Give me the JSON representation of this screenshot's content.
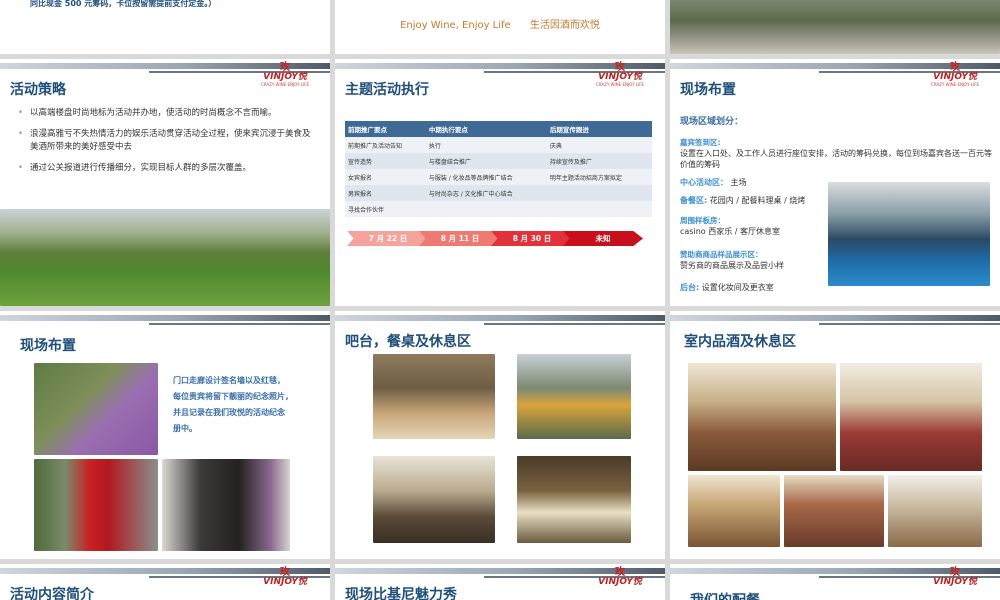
{
  "colors": {
    "title": "#1f4f7a",
    "accent": "#3f8fcf",
    "tagline": "#c77a2e",
    "logo": "#c81e1e",
    "table_header": "#3e6a95"
  },
  "logo": {
    "cn": "玫",
    "en": "VINJOY悦",
    "sub": "CRAZY WINE ENJOY LIFE"
  },
  "top_row": {
    "note": "同比现金 500 元筹码，卡位按留需提前支付定金。）",
    "tagline_en": "Enjoy Wine, Enjoy Life",
    "tagline_cn": "生活因酒而欢悦"
  },
  "strategy": {
    "title": "活动策略",
    "bullets": [
      "以高端楼盘时尚地标为活动并办地，使活动的时尚概念不言而喻。",
      "浪漫高雅亏不失热情活力的娱乐活动贯穿活动全过程，使来宾沉浸于美食及美酒所带来的美好感受中去",
      "通过公关报道进行传播细分，实现目标人群的多层次覆盖。"
    ]
  },
  "execution": {
    "title": "主题活动执行",
    "headers": [
      "前期推广要点",
      "中期执行要点",
      "后期宣传跟进"
    ],
    "rows": [
      [
        "前期推广及活动告知",
        "执行",
        "庆典"
      ],
      [
        "宣传造势",
        "与楼盘结合推广",
        "持续宣传及推广"
      ],
      [
        "女宾报名",
        "与服装 / 化妆品等品牌推广结合",
        "明年主题活动招商方案拟定"
      ],
      [
        "男宾报名",
        "与时尚杂志 / 文化推广中心结合",
        ""
      ],
      [
        "寻找合作伙伴",
        "",
        ""
      ]
    ],
    "timeline": [
      "7 月 22 日",
      "8 月 11 日",
      "8 月 30 日",
      "未知"
    ]
  },
  "layout1": {
    "title": "现场布置",
    "subtitle": "现场区域划分：",
    "zones": [
      {
        "label": "嘉宾签到区:",
        "text": "设置在入口处、及工作人员进行座位安排，活动的筹码兑换，每位到场嘉宾各送一百元等价值的筹码"
      },
      {
        "label": "中心活动区：",
        "text": "主场"
      },
      {
        "label": "备餐区:",
        "text": "花园内 / 配餐料理桌 / 烧烤"
      },
      {
        "label": "周围样板房：",
        "text": "casino 西家乐 / 客厅休息室"
      },
      {
        "label": "赞助商商品样品展示区：",
        "text": "赞劣商的商品展示及品尝小样"
      },
      {
        "label": "后台:",
        "text": "设置化妆间及更衣室"
      }
    ]
  },
  "layout2": {
    "title": "现场布置",
    "caption": [
      "门口走廊设计签名墙以及红毯，",
      "每位贵宾将留下靓丽的纪念照片，",
      "并且记录在我们玫悦的活动纪念",
      "册中。"
    ]
  },
  "bar_area": {
    "title": "吧台，餐桌及休息区"
  },
  "indoor": {
    "title": "室内品酒及休息区"
  },
  "bottom_row": {
    "t1": "活动内容简介",
    "t2": "现场比基尼魅力秀",
    "t3": "我们的配餐"
  }
}
